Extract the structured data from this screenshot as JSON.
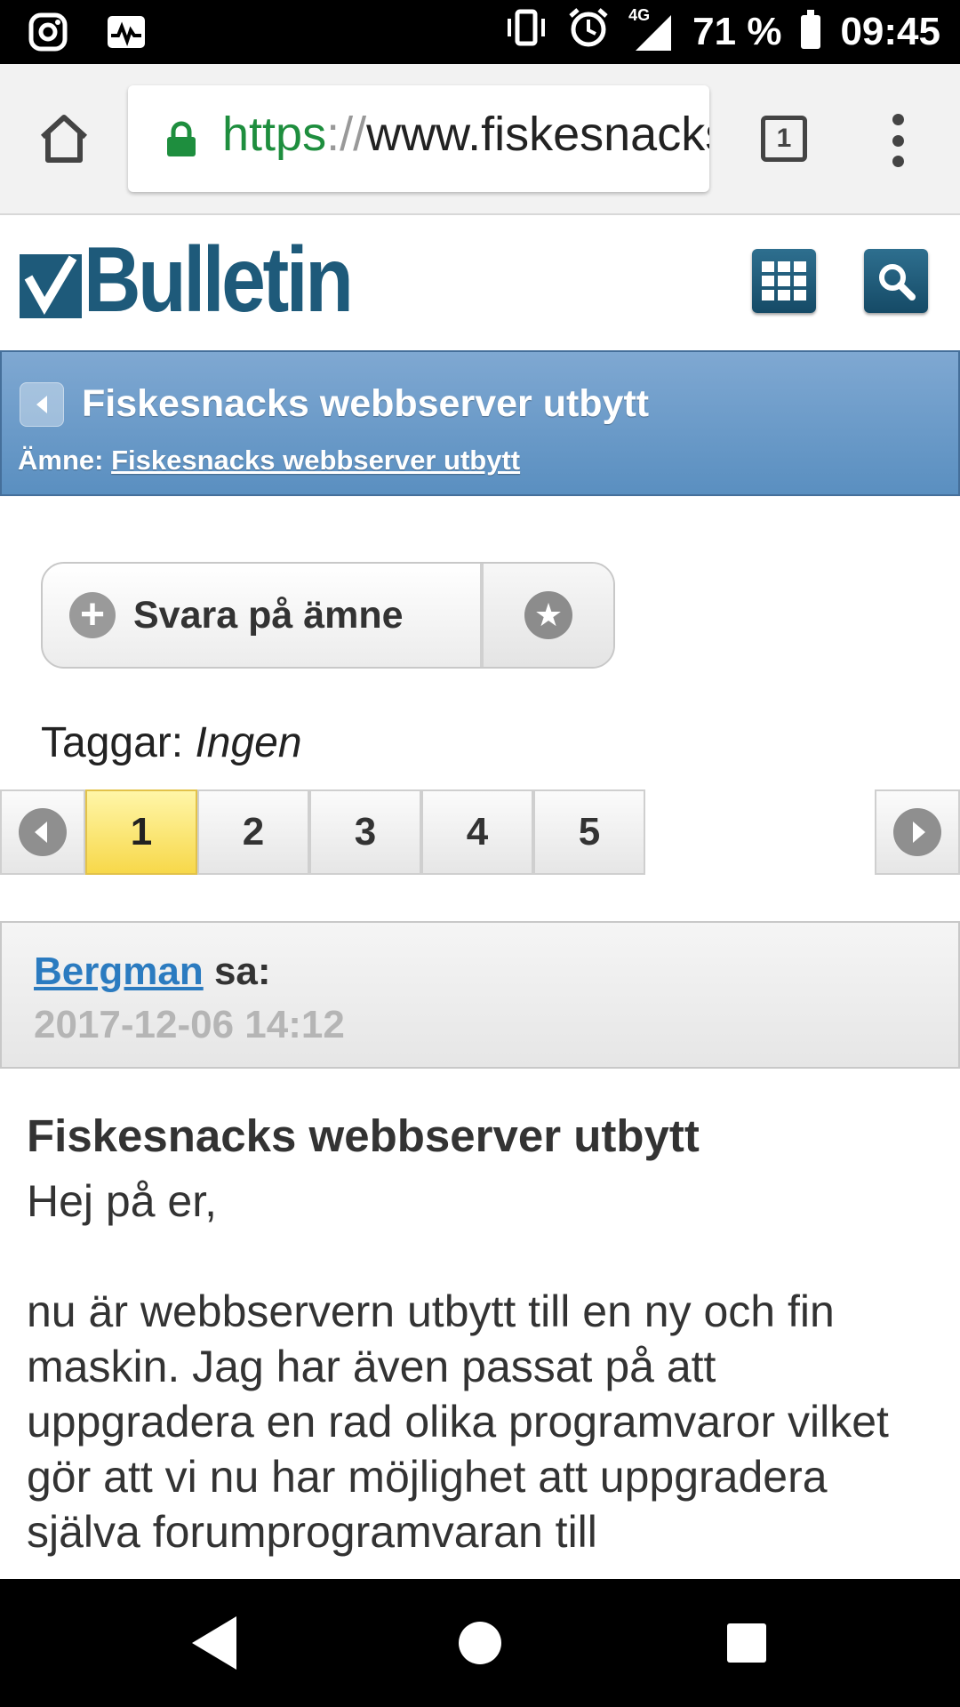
{
  "status_bar": {
    "left_icons": [
      "instagram-icon",
      "activity-icon"
    ],
    "right_icons": [
      "vibrate-icon",
      "alarm-icon",
      "signal-4g-icon",
      "battery-icon"
    ],
    "network": "4G",
    "battery": "71 %",
    "time": "09:45"
  },
  "browser": {
    "url_scheme": "https",
    "url_sep": "://",
    "url_host": "www.fiskesnacks",
    "tab_count": "1"
  },
  "site": {
    "logo_text": "Bulletin",
    "accent_color": "#1e5a7a"
  },
  "thread": {
    "title": "Fiskesnacks webbserver utbytt",
    "subject_label": "Ämne:",
    "subject_link": "Fiskesnacks webbserver utbytt"
  },
  "actions": {
    "reply_label": "Svara på ämne"
  },
  "tags": {
    "label": "Taggar:",
    "value": "Ingen"
  },
  "pagination": {
    "pages": [
      "1",
      "2",
      "3",
      "4",
      "5"
    ],
    "current": "1"
  },
  "post": {
    "author": "Bergman",
    "said": "sa:",
    "date": "2017-12-06 14:12",
    "title": "Fiskesnacks webbserver utbytt",
    "greeting": "Hej på er,",
    "body": "nu är webbservern utbytt till en ny och fin maskin. Jag har även passat på att uppgradera en rad olika programvaror vilket gör att vi nu har möjlighet att uppgradera själva forumprogramvaran till"
  }
}
